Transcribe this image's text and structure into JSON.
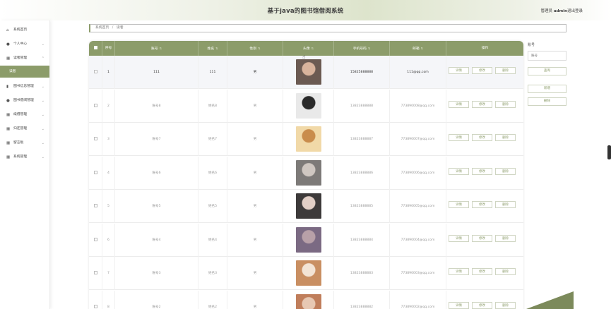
{
  "app": {
    "title": "基于java的图书馆借阅系统",
    "user_role": "管理员",
    "username": "admin",
    "logout": "退出登录"
  },
  "sidebar": {
    "items": [
      {
        "label": "系统首页",
        "icon": "home-icon"
      },
      {
        "label": "个人中心",
        "icon": "user-icon",
        "chev": "⌄"
      },
      {
        "label": "读者管理",
        "icon": "grid-icon",
        "chev": "⌃"
      },
      {
        "label": "读者",
        "active": true
      },
      {
        "label": "图书信息管理",
        "icon": "chart-icon",
        "chev": "⌄"
      },
      {
        "label": "图书借阅管理",
        "icon": "user-icon",
        "chev": "⌄"
      },
      {
        "label": "续借管理",
        "icon": "grid-icon",
        "chev": "⌄"
      },
      {
        "label": "归还管理",
        "icon": "grid-icon",
        "chev": "⌄"
      },
      {
        "label": "留言板",
        "icon": "grid-icon",
        "chev": "⌄"
      },
      {
        "label": "系统管理",
        "icon": "grid-icon",
        "chev": "⌄"
      }
    ]
  },
  "breadcrumb": {
    "home": "系统首页",
    "sep": "/",
    "current": "读者"
  },
  "table": {
    "headers": [
      "序号",
      "账号",
      "姓名",
      "性别",
      "头像",
      "手机号码",
      "邮箱",
      "操作"
    ],
    "sort_glyph": "⇅",
    "actions": {
      "detail": "详情",
      "edit": "修改",
      "delete": "删除"
    },
    "rows": [
      {
        "no": "1",
        "account": "111",
        "name": "111",
        "gender": "男",
        "phone": "15825888888",
        "email": "111@qq.com"
      },
      {
        "no": "2",
        "account": "账号8",
        "name": "姓名8",
        "gender": "男",
        "phone": "13823888888",
        "email": "773890008@qq.com"
      },
      {
        "no": "3",
        "account": "账号7",
        "name": "姓名7",
        "gender": "男",
        "phone": "13823888887",
        "email": "773890007@qq.com"
      },
      {
        "no": "4",
        "account": "账号6",
        "name": "姓名6",
        "gender": "男",
        "phone": "13823888886",
        "email": "773890006@qq.com"
      },
      {
        "no": "5",
        "account": "账号5",
        "name": "姓名5",
        "gender": "男",
        "phone": "13823888885",
        "email": "773890005@qq.com"
      },
      {
        "no": "6",
        "account": "账号4",
        "name": "姓名4",
        "gender": "男",
        "phone": "13823888884",
        "email": "773890004@qq.com"
      },
      {
        "no": "7",
        "account": "账号3",
        "name": "姓名3",
        "gender": "男",
        "phone": "13823888883",
        "email": "773890003@qq.com"
      },
      {
        "no": "8",
        "account": "账号2",
        "name": "姓名2",
        "gender": "男",
        "phone": "13823888882",
        "email": "773890002@qq.com"
      }
    ]
  },
  "search": {
    "label": "账号",
    "placeholder": "账号",
    "query_button": "查询",
    "add_button": "新增",
    "delete_button": "删除"
  },
  "colors": {
    "accent": "#8c9c6a",
    "accent_dark": "#7c8a5b"
  }
}
